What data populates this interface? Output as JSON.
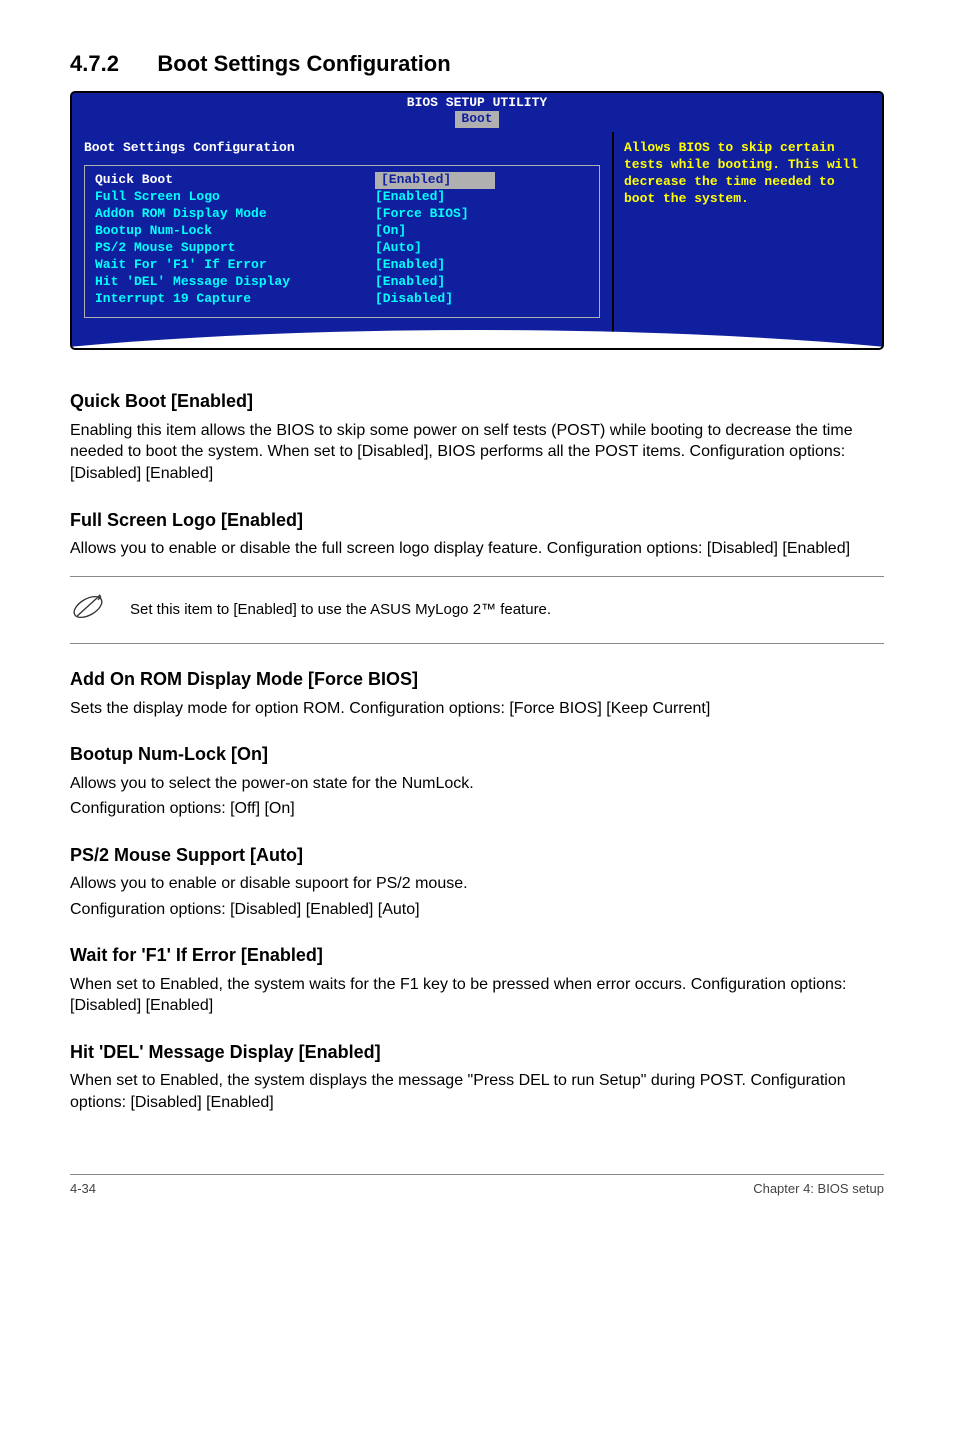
{
  "section": {
    "number": "4.7.2",
    "title": "Boot Settings Configuration"
  },
  "bios": {
    "title": "BIOS SETUP UTILITY",
    "tab": "Boot",
    "subheader": "Boot Settings Configuration",
    "options": [
      {
        "label": "Quick Boot",
        "value": "[Enabled]",
        "selected": true
      },
      {
        "label": "Full Screen Logo",
        "value": "[Enabled]"
      },
      {
        "label": "AddOn ROM Display Mode",
        "value": "[Force BIOS]"
      },
      {
        "label": "Bootup Num-Lock",
        "value": "[On]"
      },
      {
        "label": "PS/2 Mouse Support",
        "value": "[Auto]"
      },
      {
        "label": "Wait For 'F1' If Error",
        "value": "[Enabled]"
      },
      {
        "label": "Hit 'DEL' Message Display",
        "value": "[Enabled]"
      },
      {
        "label": "Interrupt 19 Capture",
        "value": "[Disabled]"
      }
    ],
    "help": "Allows BIOS to skip certain tests while booting. This will decrease the time needed to boot the system."
  },
  "items": {
    "quickboot": {
      "title": "Quick Boot [Enabled]",
      "body": "Enabling this item allows the BIOS to skip some power on self tests (POST) while booting to decrease the time needed to boot the system. When set to [Disabled], BIOS performs all the POST items. Configuration options: [Disabled] [Enabled]"
    },
    "fullscreen": {
      "title": "Full Screen Logo [Enabled]",
      "body": "Allows you to enable or disable the full screen logo display feature. Configuration options: [Disabled] [Enabled]"
    },
    "note": "Set this item to [Enabled] to use the ASUS MyLogo 2™ feature.",
    "addonrom": {
      "title": "Add On ROM Display Mode [Force BIOS]",
      "body": "Sets the display mode for option ROM. Configuration options: [Force BIOS] [Keep Current]"
    },
    "numlock": {
      "title": "Bootup Num-Lock [On]",
      "body1": "Allows you to select the power-on state for the NumLock.",
      "body2": "Configuration options: [Off] [On]"
    },
    "ps2": {
      "title": "PS/2 Mouse Support [Auto]",
      "body1": "Allows you to enable or disable supoort for PS/2 mouse.",
      "body2": "Configuration options: [Disabled] [Enabled] [Auto]"
    },
    "waitf1": {
      "title": "Wait for 'F1' If Error [Enabled]",
      "body": "When set to Enabled, the system waits for the F1 key to be pressed when error occurs. Configuration options: [Disabled] [Enabled]"
    },
    "hitdel": {
      "title": "Hit 'DEL' Message Display [Enabled]",
      "body": "When set to Enabled, the system displays the message \"Press DEL to run Setup\" during POST. Configuration options: [Disabled] [Enabled]"
    }
  },
  "footer": {
    "left": "4-34",
    "right": "Chapter 4: BIOS setup"
  }
}
